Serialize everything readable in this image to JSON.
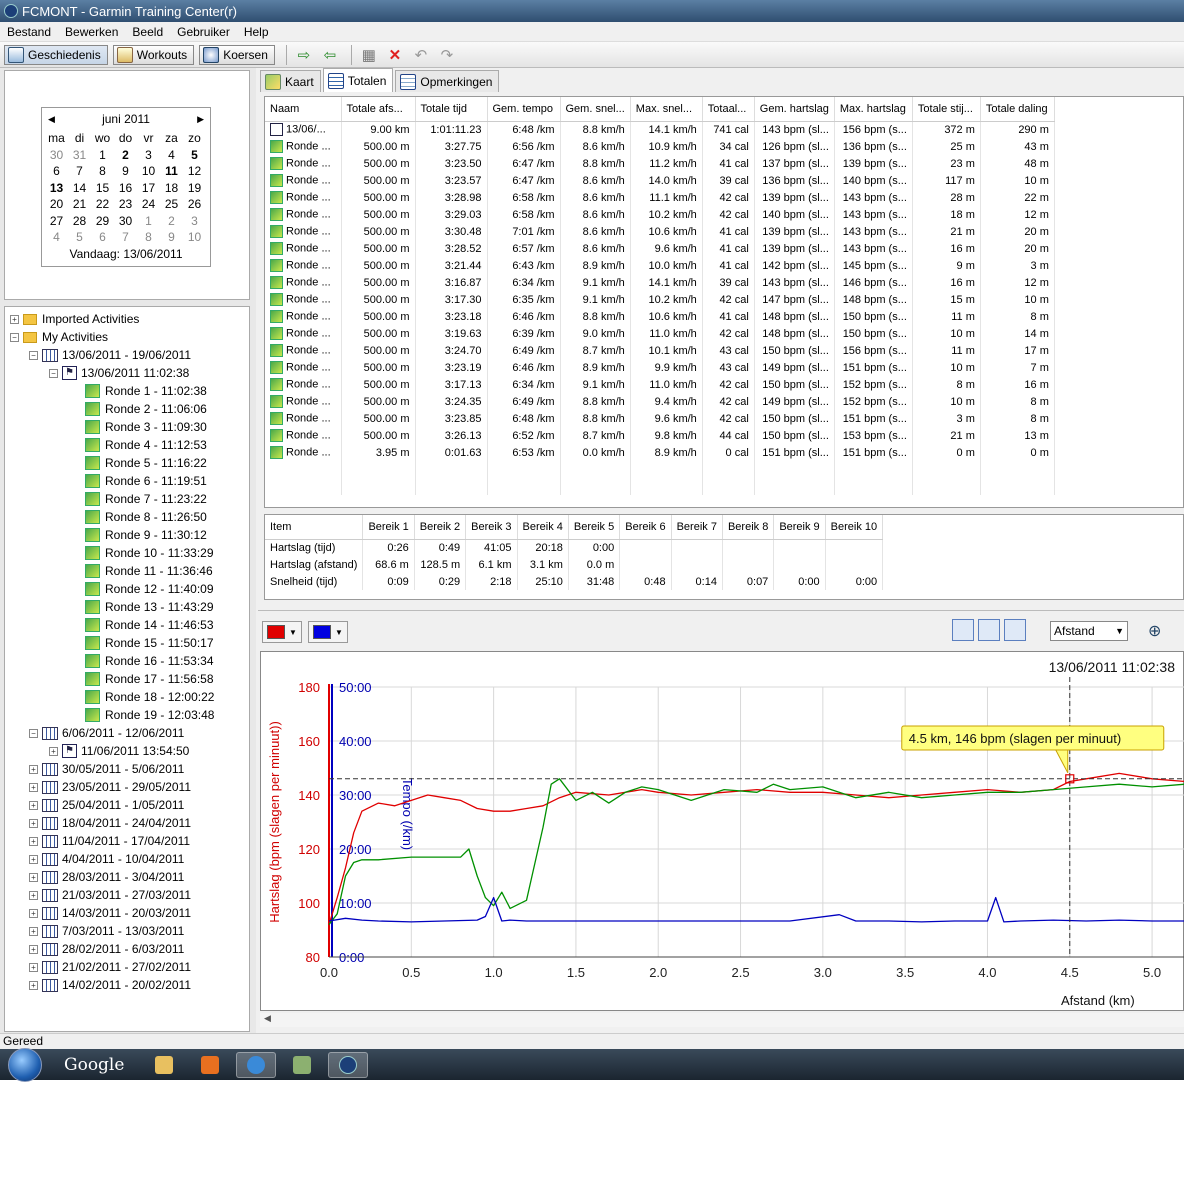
{
  "window": {
    "title": "FCMONT - Garmin Training Center(r)"
  },
  "menu": [
    "Bestand",
    "Bewerken",
    "Beeld",
    "Gebruiker",
    "Help"
  ],
  "toolbar": {
    "history": "Geschiedenis",
    "workouts": "Workouts",
    "courses": "Koersen"
  },
  "calendar": {
    "month": "juni 2011",
    "weekdays": [
      "ma",
      "di",
      "wo",
      "do",
      "vr",
      "za",
      "zo"
    ],
    "days": [
      [
        "30",
        "31",
        "1",
        "2",
        "3",
        "4",
        "5"
      ],
      [
        "6",
        "7",
        "8",
        "9",
        "10",
        "11",
        "12"
      ],
      [
        "13",
        "14",
        "15",
        "16",
        "17",
        "18",
        "19"
      ],
      [
        "20",
        "21",
        "22",
        "23",
        "24",
        "25",
        "26"
      ],
      [
        "27",
        "28",
        "29",
        "30",
        "1",
        "2",
        "3"
      ],
      [
        "4",
        "5",
        "6",
        "7",
        "8",
        "9",
        "10"
      ]
    ],
    "today": "Vandaag: 13/06/2011"
  },
  "tree": {
    "imported": "Imported Activities",
    "my": "My Activities",
    "week_current": "13/06/2011 - 19/06/2011",
    "activity": "13/06/2011 11:02:38",
    "laps": [
      "Ronde 1 - 11:02:38",
      "Ronde 2 - 11:06:06",
      "Ronde 3 - 11:09:30",
      "Ronde 4 - 11:12:53",
      "Ronde 5 - 11:16:22",
      "Ronde 6 - 11:19:51",
      "Ronde 7 - 11:23:22",
      "Ronde 8 - 11:26:50",
      "Ronde 9 - 11:30:12",
      "Ronde 10 - 11:33:29",
      "Ronde 11 - 11:36:46",
      "Ronde 12 - 11:40:09",
      "Ronde 13 - 11:43:29",
      "Ronde 14 - 11:46:53",
      "Ronde 15 - 11:50:17",
      "Ronde 16 - 11:53:34",
      "Ronde 17 - 11:56:58",
      "Ronde 18 - 12:00:22",
      "Ronde 19 - 12:03:48"
    ],
    "week_prev": "6/06/2011 - 12/06/2011",
    "activity_prev": "11/06/2011 13:54:50",
    "weeks": [
      "30/05/2011 - 5/06/2011",
      "23/05/2011 - 29/05/2011",
      "25/04/2011 - 1/05/2011",
      "18/04/2011 - 24/04/2011",
      "11/04/2011 - 17/04/2011",
      "4/04/2011 - 10/04/2011",
      "28/03/2011 - 3/04/2011",
      "21/03/2011 - 27/03/2011",
      "14/03/2011 - 20/03/2011",
      "7/03/2011 - 13/03/2011",
      "28/02/2011 - 6/03/2011",
      "21/02/2011 - 27/02/2011",
      "14/02/2011 - 20/02/2011"
    ]
  },
  "tabs": [
    "Kaart",
    "Totalen",
    "Opmerkingen"
  ],
  "laps_table": {
    "headers": [
      "Naam",
      "Totale afs...",
      "Totale tijd",
      "Gem. tempo",
      "Gem. snel...",
      "Max. snel...",
      "Totaal...",
      "Gem. hartslag",
      "Max. hartslag",
      "Totale stij...",
      "Totale daling"
    ],
    "rows": [
      [
        "13/06/...",
        "9.00 km",
        "1:01:11.23",
        "6:48 /km",
        "8.8 km/h",
        "14.1 km/h",
        "741 cal",
        "143 bpm (sl...",
        "156 bpm (s...",
        "372 m",
        "290 m"
      ],
      [
        "Ronde ...",
        "500.00 m",
        "3:27.75",
        "6:56 /km",
        "8.6 km/h",
        "10.9 km/h",
        "34 cal",
        "126 bpm (sl...",
        "136 bpm (s...",
        "25 m",
        "43 m"
      ],
      [
        "Ronde ...",
        "500.00 m",
        "3:23.50",
        "6:47 /km",
        "8.8 km/h",
        "11.2 km/h",
        "41 cal",
        "137 bpm (sl...",
        "139 bpm (s...",
        "23 m",
        "48 m"
      ],
      [
        "Ronde ...",
        "500.00 m",
        "3:23.57",
        "6:47 /km",
        "8.6 km/h",
        "14.0 km/h",
        "39 cal",
        "136 bpm (sl...",
        "140 bpm (s...",
        "117 m",
        "10 m"
      ],
      [
        "Ronde ...",
        "500.00 m",
        "3:28.98",
        "6:58 /km",
        "8.6 km/h",
        "11.1 km/h",
        "42 cal",
        "139 bpm (sl...",
        "143 bpm (s...",
        "28 m",
        "22 m"
      ],
      [
        "Ronde ...",
        "500.00 m",
        "3:29.03",
        "6:58 /km",
        "8.6 km/h",
        "10.2 km/h",
        "42 cal",
        "140 bpm (sl...",
        "143 bpm (s...",
        "18 m",
        "12 m"
      ],
      [
        "Ronde ...",
        "500.00 m",
        "3:30.48",
        "7:01 /km",
        "8.6 km/h",
        "10.6 km/h",
        "41 cal",
        "139 bpm (sl...",
        "143 bpm (s...",
        "21 m",
        "20 m"
      ],
      [
        "Ronde ...",
        "500.00 m",
        "3:28.52",
        "6:57 /km",
        "8.6 km/h",
        "9.6 km/h",
        "41 cal",
        "139 bpm (sl...",
        "143 bpm (s...",
        "16 m",
        "20 m"
      ],
      [
        "Ronde ...",
        "500.00 m",
        "3:21.44",
        "6:43 /km",
        "8.9 km/h",
        "10.0 km/h",
        "41 cal",
        "142 bpm (sl...",
        "145 bpm (s...",
        "9 m",
        "3 m"
      ],
      [
        "Ronde ...",
        "500.00 m",
        "3:16.87",
        "6:34 /km",
        "9.1 km/h",
        "14.1 km/h",
        "39 cal",
        "143 bpm (sl...",
        "146 bpm (s...",
        "16 m",
        "12 m"
      ],
      [
        "Ronde ...",
        "500.00 m",
        "3:17.30",
        "6:35 /km",
        "9.1 km/h",
        "10.2 km/h",
        "42 cal",
        "147 bpm (sl...",
        "148 bpm (s...",
        "15 m",
        "10 m"
      ],
      [
        "Ronde ...",
        "500.00 m",
        "3:23.18",
        "6:46 /km",
        "8.8 km/h",
        "10.6 km/h",
        "41 cal",
        "148 bpm (sl...",
        "150 bpm (s...",
        "11 m",
        "8 m"
      ],
      [
        "Ronde ...",
        "500.00 m",
        "3:19.63",
        "6:39 /km",
        "9.0 km/h",
        "11.0 km/h",
        "42 cal",
        "148 bpm (sl...",
        "150 bpm (s...",
        "10 m",
        "14 m"
      ],
      [
        "Ronde ...",
        "500.00 m",
        "3:24.70",
        "6:49 /km",
        "8.7 km/h",
        "10.1 km/h",
        "43 cal",
        "150 bpm (sl...",
        "156 bpm (s...",
        "11 m",
        "17 m"
      ],
      [
        "Ronde ...",
        "500.00 m",
        "3:23.19",
        "6:46 /km",
        "8.9 km/h",
        "9.9 km/h",
        "43 cal",
        "149 bpm (sl...",
        "151 bpm (s...",
        "10 m",
        "7 m"
      ],
      [
        "Ronde ...",
        "500.00 m",
        "3:17.13",
        "6:34 /km",
        "9.1 km/h",
        "11.0 km/h",
        "42 cal",
        "150 bpm (sl...",
        "152 bpm (s...",
        "8 m",
        "16 m"
      ],
      [
        "Ronde ...",
        "500.00 m",
        "3:24.35",
        "6:49 /km",
        "8.8 km/h",
        "9.4 km/h",
        "42 cal",
        "149 bpm (sl...",
        "152 bpm (s...",
        "10 m",
        "8 m"
      ],
      [
        "Ronde ...",
        "500.00 m",
        "3:23.85",
        "6:48 /km",
        "8.8 km/h",
        "9.6 km/h",
        "42 cal",
        "150 bpm (sl...",
        "151 bpm (s...",
        "3 m",
        "8 m"
      ],
      [
        "Ronde ...",
        "500.00 m",
        "3:26.13",
        "6:52 /km",
        "8.7 km/h",
        "9.8 km/h",
        "44 cal",
        "150 bpm (sl...",
        "153 bpm (s...",
        "21 m",
        "13 m"
      ],
      [
        "Ronde ...",
        "3.95 m",
        "0:01.63",
        "6:53 /km",
        "0.0 km/h",
        "8.9 km/h",
        "0 cal",
        "151 bpm (sl...",
        "151 bpm (s...",
        "0 m",
        "0 m"
      ]
    ]
  },
  "zones_table": {
    "headers": [
      "Item",
      "Bereik 1",
      "Bereik 2",
      "Bereik 3",
      "Bereik 4",
      "Bereik 5",
      "Bereik 6",
      "Bereik 7",
      "Bereik 8",
      "Bereik 9",
      "Bereik 10"
    ],
    "rows": [
      [
        "Hartslag (tijd)",
        "0:26",
        "0:49",
        "41:05",
        "20:18",
        "0:00",
        "",
        "",
        "",
        "",
        ""
      ],
      [
        "Hartslag (afstand)",
        "68.6 m",
        "128.5 m",
        "6.1 km",
        "3.1 km",
        "0.0 m",
        "",
        "",
        "",
        "",
        ""
      ],
      [
        "Snelheid (tijd)",
        "0:09",
        "0:29",
        "2:18",
        "25:10",
        "31:48",
        "0:48",
        "0:14",
        "0:07",
        "0:00",
        "0:00"
      ]
    ]
  },
  "chart_controls": {
    "xaxis_select": "Afstand"
  },
  "status": "Gereed",
  "taskbar": {
    "search": "Google"
  },
  "colors": {
    "heart_rate": "#e00000",
    "pace": "#0000c0",
    "elevation": "#009000",
    "tooltip": "#ffff80"
  },
  "chart_data": {
    "type": "line",
    "title": "13/06/2011 11:02:38",
    "xlabel": "Afstand (km)",
    "ylabel": "Hartslag (bpm (slagen per minuut))",
    "y2label": "Tempo (/km)",
    "xlim": [
      0,
      5.2
    ],
    "ylim": [
      80,
      180
    ],
    "y2lim": [
      "0:00",
      "50:00"
    ],
    "x_ticks": [
      "0.0",
      "0.5",
      "1.0",
      "1.5",
      "2.0",
      "2.5",
      "3.0",
      "3.5",
      "4.0",
      "4.5",
      "5.0"
    ],
    "y_ticks": [
      "180",
      "160",
      "140",
      "120",
      "100",
      "80"
    ],
    "y2_ticks": [
      "50:00",
      "40:00",
      "30:00",
      "20:00",
      "10:00",
      "0:00"
    ],
    "grid": true,
    "tooltip": "4.5 km, 146 bpm (slagen per minuut)",
    "cursor": {
      "x": 4.5,
      "y": 146
    },
    "series": [
      {
        "role": "hr",
        "color": "#e00000",
        "x": [
          0,
          0.05,
          0.1,
          0.15,
          0.2,
          0.3,
          0.4,
          0.5,
          0.6,
          0.7,
          0.8,
          0.9,
          1.0,
          1.1,
          1.2,
          1.3,
          1.4,
          1.5,
          1.7,
          1.9,
          2.0,
          2.2,
          2.4,
          2.6,
          2.8,
          3.0,
          3.2,
          3.4,
          3.6,
          3.8,
          4.0,
          4.2,
          4.4,
          4.5,
          4.6,
          4.8,
          5.0,
          5.2
        ],
        "y": [
          92,
          102,
          113,
          126,
          134,
          137,
          136,
          138,
          140,
          139,
          138,
          135,
          134,
          134,
          135,
          136,
          139,
          141,
          140,
          142,
          141,
          140,
          141,
          142,
          141,
          141,
          140,
          139,
          140,
          141,
          142,
          141,
          142,
          145,
          146,
          148,
          146,
          145
        ]
      },
      {
        "role": "elev",
        "color": "#009000",
        "x": [
          0,
          0.05,
          0.1,
          0.15,
          0.2,
          0.3,
          0.5,
          0.7,
          0.8,
          0.85,
          0.9,
          0.95,
          1.0,
          1.05,
          1.1,
          1.2,
          1.3,
          1.35,
          1.4,
          1.5,
          1.6,
          1.7,
          1.8,
          1.9,
          2.0,
          2.2,
          2.4,
          2.6,
          2.7,
          2.8,
          3.0,
          3.2,
          3.4,
          3.6,
          3.8,
          4.0,
          4.2,
          4.4,
          4.6,
          4.8,
          5.0,
          5.2
        ],
        "y": [
          92,
          96,
          110,
          115,
          116,
          116,
          117,
          117,
          117,
          120,
          110,
          102,
          99,
          104,
          98,
          101,
          128,
          144,
          146,
          138,
          141,
          137,
          141,
          143,
          142,
          138,
          142,
          141,
          144,
          142,
          143,
          139,
          141,
          139,
          140,
          141,
          141,
          142,
          143,
          144,
          143,
          144
        ]
      },
      {
        "role": "pace",
        "color": "#0000c0",
        "x": [
          0,
          0.1,
          0.2,
          0.3,
          0.5,
          0.7,
          0.9,
          0.95,
          1.0,
          1.05,
          1.1,
          1.2,
          1.4,
          1.6,
          2.0,
          2.4,
          2.8,
          3.1,
          3.2,
          3.4,
          3.6,
          3.8,
          4.0,
          4.05,
          4.1,
          4.2,
          4.4,
          4.6,
          4.8,
          5.0,
          5.2
        ],
        "y": [
          "6:40",
          "7:10",
          "6:50",
          "6:40",
          "6:30",
          "6:40",
          "6:50",
          "7:30",
          "11:00",
          "6:40",
          "6:50",
          "6:40",
          "6:40",
          "6:40",
          "6:40",
          "6:40",
          "6:40",
          "7:50",
          "6:40",
          "6:40",
          "6:30",
          "6:40",
          "6:40",
          "11:00",
          "6:30",
          "6:40",
          "6:50",
          "6:40",
          "6:50",
          "6:40",
          "6:40"
        ]
      }
    ]
  }
}
